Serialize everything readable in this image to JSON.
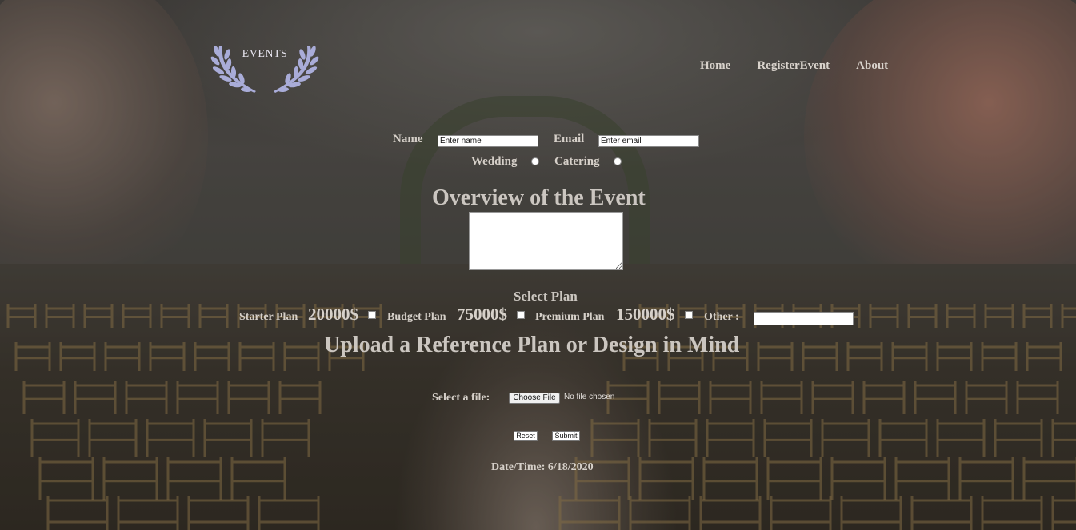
{
  "logo": {
    "text": "EVENTS",
    "icon": "laurel-wreath-icon"
  },
  "nav": {
    "home": "Home",
    "register": "RegisterEvent",
    "about": "About"
  },
  "form": {
    "name_label": "Name",
    "name_placeholder": "Enter name",
    "email_label": "Email",
    "email_placeholder": "Enter email",
    "event_types": [
      "Wedding",
      "Catering"
    ],
    "overview_heading": "Overview of the Event",
    "select_plan_heading": "Select Plan",
    "plans": [
      {
        "label": "Starter Plan",
        "price": "20000$"
      },
      {
        "label": "Budget Plan",
        "price": "75000$"
      },
      {
        "label": "Premium Plan",
        "price": "150000$"
      }
    ],
    "other_label": "Other :",
    "upload_heading": "Upload a Reference Plan or Design in Mind",
    "file_label": "Select a file:",
    "file_button": "Choose File",
    "file_status": "No file chosen",
    "reset_label": "Reset",
    "submit_label": "Submit",
    "datetime": "Date/Time: 6/18/2020"
  },
  "colors": {
    "text": "#d6d0c9",
    "heading": "#cbc6c0",
    "logo": "#b7b9e0"
  }
}
